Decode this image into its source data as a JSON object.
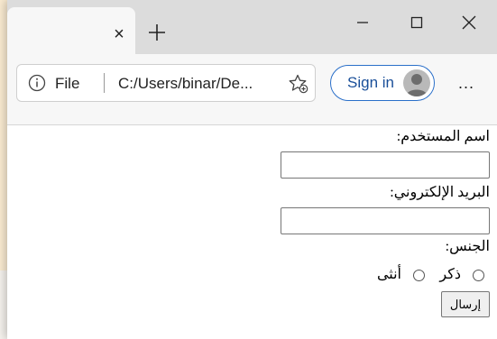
{
  "browser": {
    "tab": {
      "close_glyph": "×"
    },
    "new_tab_icon": "plus-icon",
    "window_controls": [
      "minimize-icon",
      "maximize-icon",
      "close-icon"
    ],
    "address": {
      "info_icon": "info-icon",
      "scheme_label": "File",
      "url": "C:/Users/binar/De..."
    },
    "favorites_icon": "add-favorite-icon",
    "signin_label": "Sign in",
    "more_label": "...",
    "accent_color": "#2a6fc9"
  },
  "form": {
    "username_label": "اسم المستخدم:",
    "email_label": "البريد الإلكتروني:",
    "gender_label": "الجنس:",
    "male_label": "ذكر",
    "female_label": "أنثى",
    "submit_label": "إرسال"
  }
}
